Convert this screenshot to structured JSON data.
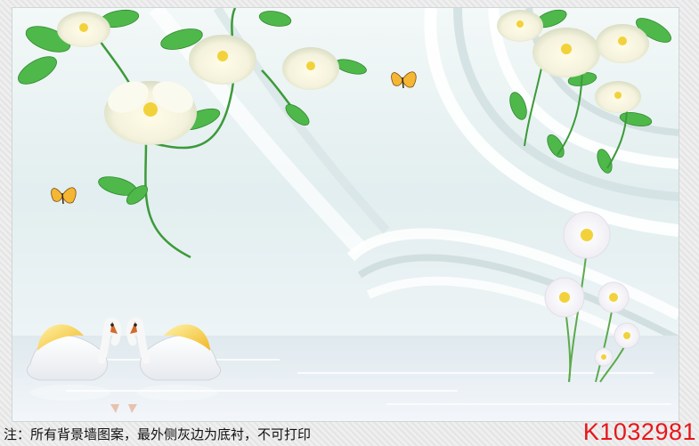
{
  "note": {
    "text": "注：所有背景墙图案，最外侧灰边为底衬，不可打印"
  },
  "product_code": "K1032981",
  "colors": {
    "code_red": "#e8161b",
    "leaf_green": "#4fb84a",
    "bloom_cream": "#f8f6e4",
    "bloom_center": "#f2d23a",
    "swan_gold": "#f3c53a",
    "backdrop": "#e2eeef"
  },
  "artwork": {
    "icons": [
      "magnolia-icon",
      "leaf-icon",
      "butterfly-icon",
      "swan-icon",
      "daisy-icon",
      "water-reflection"
    ]
  }
}
